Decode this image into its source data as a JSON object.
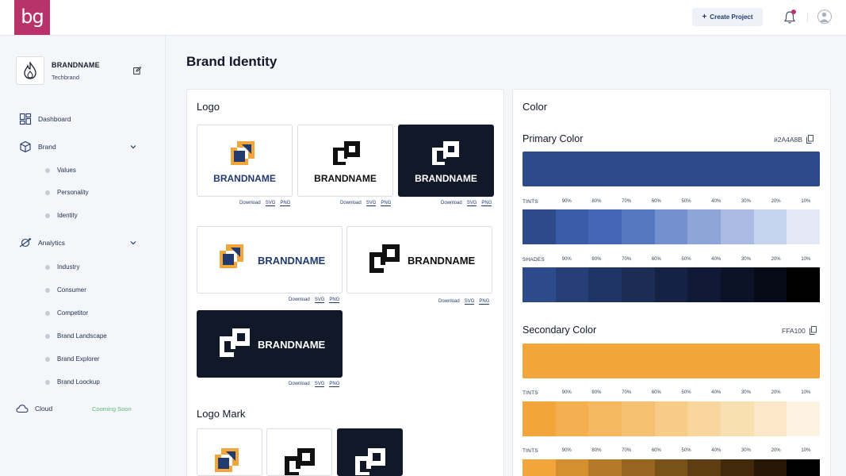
{
  "app": {
    "logo_text": "bg",
    "create_project": "Create Project"
  },
  "sidebar": {
    "brand_name": "BRANDNAME",
    "brand_sub": "Techbrand",
    "nav": {
      "dashboard": "Dashboard",
      "brand": "Brand",
      "brand_items": [
        "Values",
        "Personality",
        "Identity"
      ],
      "analytics": "Analytics",
      "analytics_items": [
        "Industry",
        "Consumer",
        "Competitor",
        "Brand Landscape",
        "Brand Explorer",
        "Brand Loockup"
      ],
      "cloud": "Cloud",
      "cloud_badge": "Cooming Soon"
    }
  },
  "main": {
    "title": "Brand Identity",
    "logo_panel": {
      "title": "Logo",
      "wordmark": "BRANDNAME",
      "download": "Download",
      "svg": "SVG",
      "png": "PNG",
      "logo_mark_title": "Logo Mark"
    },
    "color_panel": {
      "title": "Color",
      "tints_label": "TINTS",
      "shades_label": "SHADES",
      "percentages": [
        "90%",
        "80%",
        "70%",
        "60%",
        "50%",
        "40%",
        "30%",
        "20%",
        "10%"
      ],
      "primary": {
        "label": "Primary Color",
        "hex": "#2A4A8B",
        "color": "#2d4a8a",
        "tints": [
          "#2d4a8a",
          "#3a5ca8",
          "#4566b4",
          "#5677c2",
          "#7390cf",
          "#8ea5d8",
          "#a9bbe2",
          "#c6d3ee",
          "#e3e9f6"
        ],
        "shades": [
          "#2d4a8a",
          "#263f77",
          "#203566",
          "#1b2c55",
          "#152244",
          "#101a36",
          "#0c1328",
          "#070b18",
          "#000000"
        ]
      },
      "secondary": {
        "label": "Secondary Color",
        "hex": "FFA100",
        "color": "#f2a53a",
        "tints": [
          "#f2a53a",
          "#f4b050",
          "#f5b860",
          "#f6c172",
          "#f7cc89",
          "#f9d69d",
          "#fadfb2",
          "#fce8c9",
          "#fdf3e2"
        ],
        "shades": [
          "#f2a53a",
          "#d4902f",
          "#b57a27",
          "#97651f",
          "#7a5119",
          "#5e3d12",
          "#42290c",
          "#271706",
          "#000000"
        ]
      }
    }
  },
  "colors": {
    "accent": "#b7336a",
    "navy": "#223a6e",
    "dark_tile": "#111827",
    "gold": "#f2a53a"
  }
}
